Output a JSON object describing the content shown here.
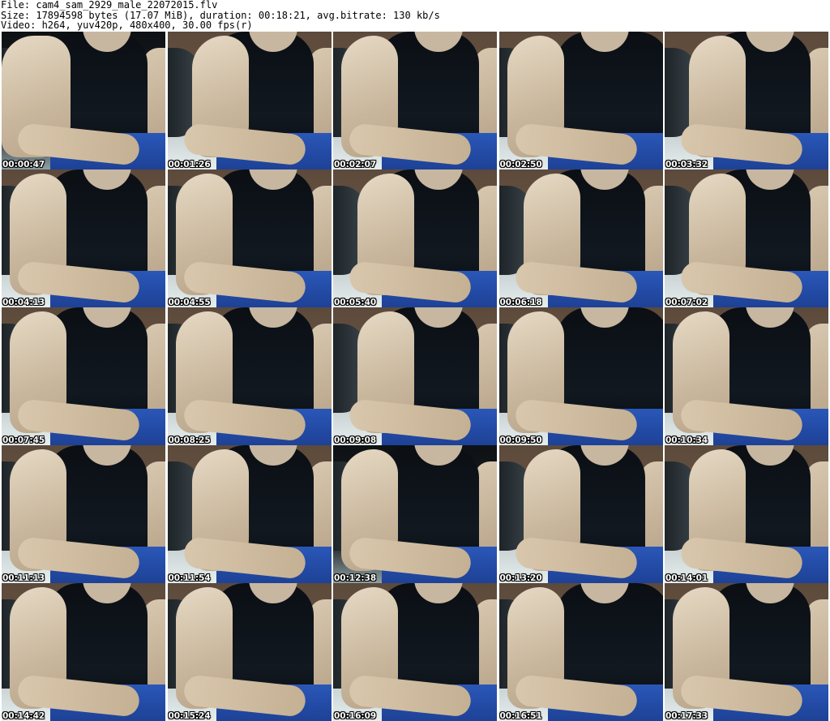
{
  "header": {
    "line1": "File: cam4_sam_2929_male_22072015.flv",
    "line2": "Size: 17894598 bytes (17.07 MiB), duration: 00:18:21, avg.bitrate: 130 kb/s",
    "line3": "Video: h264, yuv420p, 480x400, 30.00 fps(r)"
  },
  "thumbnails": [
    {
      "time": "00:00:47",
      "variant": "v-dark v-left"
    },
    {
      "time": "00:01:26",
      "variant": "v-right"
    },
    {
      "time": "00:02:07",
      "variant": ""
    },
    {
      "time": "00:02:50",
      "variant": "v-lean"
    },
    {
      "time": "00:03:32",
      "variant": "v-right"
    },
    {
      "time": "00:04:13",
      "variant": ""
    },
    {
      "time": "00:04:55",
      "variant": ""
    },
    {
      "time": "00:05:40",
      "variant": "v-right"
    },
    {
      "time": "00:06:18",
      "variant": "v-right"
    },
    {
      "time": "00:07:02",
      "variant": "v-right"
    },
    {
      "time": "00:07:45",
      "variant": ""
    },
    {
      "time": "00:08:25",
      "variant": ""
    },
    {
      "time": "00:09:08",
      "variant": "v-right"
    },
    {
      "time": "00:09:50",
      "variant": "v-lean"
    },
    {
      "time": "00:10:34",
      "variant": ""
    },
    {
      "time": "00:11:13",
      "variant": ""
    },
    {
      "time": "00:11:54",
      "variant": "v-right"
    },
    {
      "time": "00:12:38",
      "variant": "v-dark"
    },
    {
      "time": "00:13:20",
      "variant": "v-right"
    },
    {
      "time": "00:14:01",
      "variant": "v-right"
    },
    {
      "time": "00:14:42",
      "variant": ""
    },
    {
      "time": "00:15:24",
      "variant": ""
    },
    {
      "time": "00:16:09",
      "variant": ""
    },
    {
      "time": "00:16:51",
      "variant": "v-lean"
    },
    {
      "time": "00:17:33",
      "variant": ""
    }
  ]
}
